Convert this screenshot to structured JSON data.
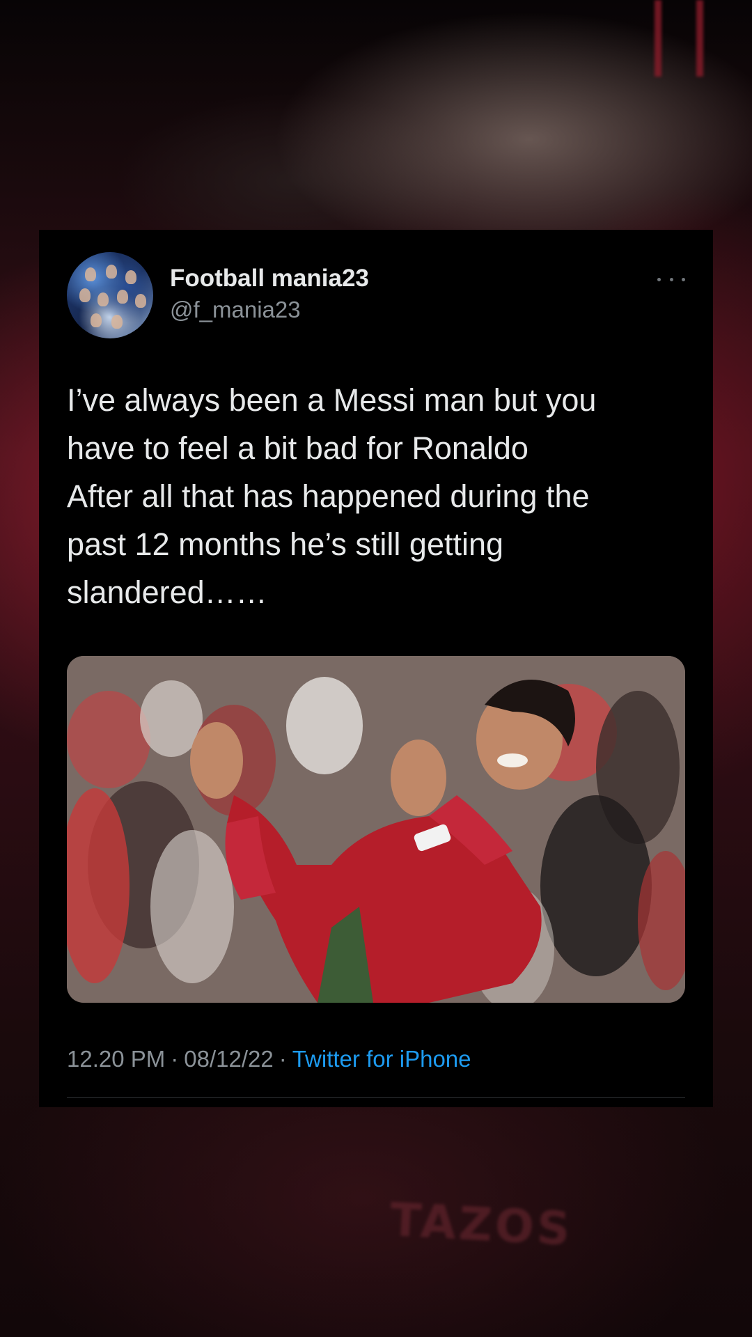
{
  "tweet": {
    "display_name": "Football mania23",
    "handle": "@f_mania23",
    "text": "I’ve always been a Messi man but you\nhave to feel a bit bad for Ronaldo\nAfter all that has happened during the\npast 12 months he’s still getting\nslandered……",
    "time": "12.20 PM",
    "date": "08/12/22",
    "separator": "·",
    "source": "Twitter for iPhone",
    "more_icon": "ellipsis-icon"
  },
  "background": {
    "jersey_text": "TAZOS"
  },
  "colors": {
    "card_background": "#000000",
    "primary_text": "#e7e9ea",
    "secondary_text": "#8b9298",
    "link": "#1d9bf0",
    "divider": "#2f3336"
  }
}
